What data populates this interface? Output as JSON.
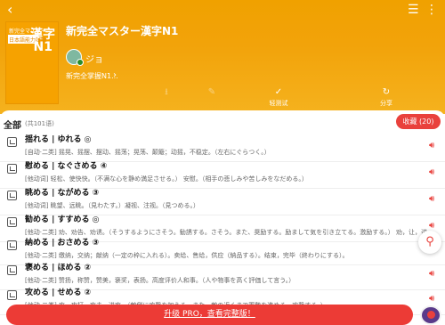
{
  "header": {
    "back_icon": "chevron-left-icon",
    "list_icon": "list-icon",
    "more_icon": "more-icon",
    "book_title": "新完全マスター漢字N1",
    "author": "ジョ",
    "source": "新完全掌握N1...",
    "cover": {
      "line1": "新完全マスター",
      "big": "漢字",
      "line2": "日本語能力試験",
      "level": "N1"
    },
    "actions": [
      {
        "icon": "download-icon",
        "label": ""
      },
      {
        "icon": "edit-icon",
        "label": ""
      },
      {
        "icon": "check-circle-icon",
        "label": "轻测试"
      },
      {
        "icon": "share-icon",
        "label": "分享"
      }
    ]
  },
  "list": {
    "all_label": "全部",
    "count": "(共101语)",
    "collect": "收藏 (20)",
    "items": [
      {
        "word": "揺れる | ゆれる ◎",
        "meaning": "[自动·二类] 摇晃、摇摆、摆动、摇荡；晃荡、颠簸；动摇，不稳定。（左右にぐらつく。）"
      },
      {
        "word": "慰める | なぐさめる ④",
        "meaning": "[他动词] 轻松、使快快。（不满な心を静め満足させる。） 安慰。（相手の悲しみや苦しみをなだめる。）"
      },
      {
        "word": "眺める | ながめる ③",
        "meaning": "[他动词] 眺望、远眺。（見わたす。）凝视、注视。（見つめる。）"
      },
      {
        "word": "勧める | すすめる ◎",
        "meaning": "[他动·二类] 劝、劝告、劝诱。（そうするようにさそう。勧誘する。さそう。また、奨励する。励まして気を引き立てる。激励する。） 劝，让，进。"
      },
      {
        "word": "納める | おさめる ③",
        "meaning": "[他动·二类] 缴纳，交纳；献纳（一定の枠に入れる）。卖给、售给，供应（納品する）。结束，完毕（終わりにする）。"
      },
      {
        "word": "褒める | ほめる ②",
        "meaning": "[他动·二类] 赞扬，称赞，赞美，褒奖，表扬。高度评价人和事。（人や物事を高く評価して言う。）"
      },
      {
        "word": "攻める | せめる ②",
        "meaning": "[他动·二类] 攻，攻打，攻击，进攻。（敵側に攻撃を加える。また、敵の近くまで軍勢を進める。攻撃する。）"
      }
    ]
  },
  "upgrade_label": "升级 PRO，查看完整版！",
  "colors": {
    "accent": "#e9413c",
    "header": "#f2a30a"
  }
}
